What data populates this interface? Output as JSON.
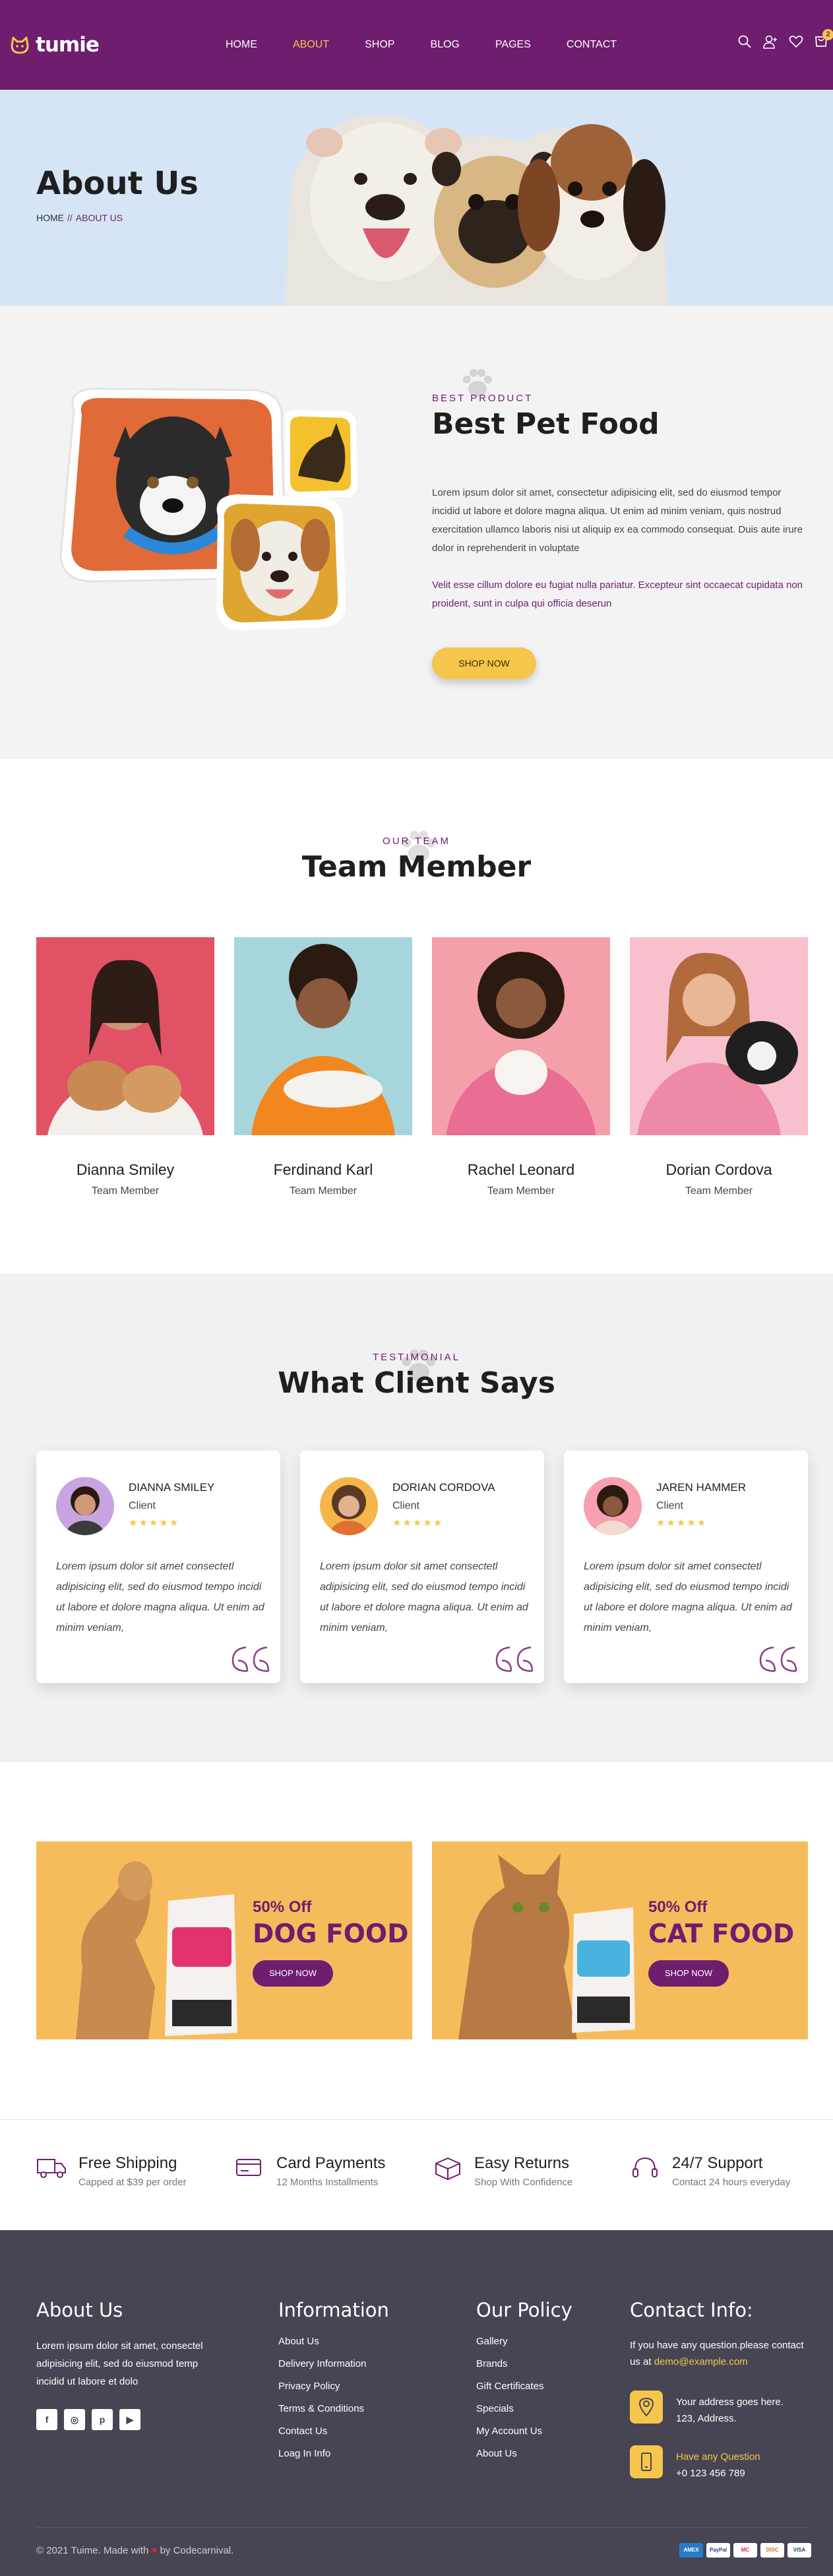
{
  "colors": {
    "brand": "#6e1d6f",
    "accent": "#f6c64c",
    "banner_bg": "#d5e5f5",
    "footer_bg": "#474553"
  },
  "header": {
    "logo": "tumie",
    "nav": [
      {
        "label": "HOME"
      },
      {
        "label": "ABOUT"
      },
      {
        "label": "SHOP"
      },
      {
        "label": "BLOG"
      },
      {
        "label": "PAGES"
      },
      {
        "label": "CONTACT"
      }
    ],
    "active_nav": "ABOUT",
    "icons": [
      "search-icon",
      "user-icon",
      "heart-icon",
      "cart-icon"
    ],
    "cart_count": "2"
  },
  "banner": {
    "title": "About Us",
    "crumb_home": "HOME",
    "crumb_sep": "//",
    "crumb_current": "ABOUT US"
  },
  "about": {
    "eyebrow": "BEST PRODUCT",
    "title": "Best Pet Food",
    "para1": "Lorem ipsum dolor sit amet, consectetur adipisicing elit, sed do eiusmod tempor incidid ut labore et dolore magna aliqua. Ut enim ad minim veniam, quis nostrud exercitation ullamco laboris nisi ut aliquip ex ea commodo consequat. Duis aute irure dolor in reprehenderit in voluptate",
    "para2": "Velit esse cillum dolore eu fugiat nulla pariatur. Excepteur sint occaecat cupidata non proident, sunt in culpa qui officia deserun",
    "button": "SHOP NOW"
  },
  "team": {
    "eyebrow": "OUR TEAM",
    "title": "Team Member",
    "members": [
      {
        "name": "Dianna Smiley",
        "role": "Team Member"
      },
      {
        "name": "Ferdinand Karl",
        "role": "Team Member"
      },
      {
        "name": "Rachel Leonard",
        "role": "Team Member"
      },
      {
        "name": "Dorian Cordova",
        "role": "Team Member"
      }
    ]
  },
  "testimonial": {
    "eyebrow": "TESTIMONIAL",
    "title": "What Client Says",
    "items": [
      {
        "name": "DIANNA SMILEY",
        "role": "Client",
        "stars": "★★★★★",
        "rating": 5,
        "text": "Lorem ipsum dolor sit amet consectetl adipisicing elit, sed do eiusmod tempo incidi ut labore et dolore magna aliqua. Ut enim ad minim veniam,"
      },
      {
        "name": "DORIAN CORDOVA",
        "role": "Client",
        "stars": "★★★★★",
        "rating": 5,
        "text": "Lorem ipsum dolor sit amet consectetl adipisicing elit, sed do eiusmod tempo incidi ut labore et dolore magna aliqua. Ut enim ad minim veniam,"
      },
      {
        "name": "JAREN HAMMER",
        "role": "Client",
        "stars": "★★★★★",
        "rating": 5,
        "text": "Lorem ipsum dolor sit amet consectetl adipisicing elit, sed do eiusmod tempo incidi ut labore et dolore magna aliqua. Ut enim ad minim veniam,"
      }
    ]
  },
  "promos": [
    {
      "offer": "50% Off",
      "title": "DOG FOOD",
      "button": "SHOP NOW"
    },
    {
      "offer": "50% Off",
      "title": "CAT FOOD",
      "button": "SHOP NOW"
    }
  ],
  "features": [
    {
      "icon": "truck-icon",
      "title": "Free Shipping",
      "sub": "Capped at $39 per order"
    },
    {
      "icon": "card-icon",
      "title": "Card Payments",
      "sub": "12 Months Installments"
    },
    {
      "icon": "box-icon",
      "title": "Easy Returns",
      "sub": "Shop With Confidence"
    },
    {
      "icon": "headset-icon",
      "title": "24/7 Support",
      "sub": "Contact 24 hours everyday"
    }
  ],
  "footer": {
    "about_title": "About Us",
    "about_text": "Lorem ipsum dolor sit amet, consectel adipisicing elit, sed do eiusmod temp incidid ut labore et dolo",
    "social": [
      {
        "icon": "facebook-icon",
        "glyph": "f"
      },
      {
        "icon": "instagram-icon",
        "glyph": "◎"
      },
      {
        "icon": "pinterest-icon",
        "glyph": "p"
      },
      {
        "icon": "youtube-icon",
        "glyph": "▶"
      }
    ],
    "info_title": "Information",
    "info_links": [
      {
        "label": "About Us"
      },
      {
        "label": "Delivery Information"
      },
      {
        "label": "Privacy Policy"
      },
      {
        "label": "Terms & Conditions"
      },
      {
        "label": "Contact Us"
      },
      {
        "label": "Loag In Info"
      }
    ],
    "policy_title": "Our Policy",
    "policy_links": [
      {
        "label": "Gallery"
      },
      {
        "label": "Brands"
      },
      {
        "label": "Gift Certificates"
      },
      {
        "label": "Specials"
      },
      {
        "label": "My Account Us"
      },
      {
        "label": "About Us"
      }
    ],
    "contact_title": "Contact Info:",
    "contact_intro": "If you have any question.please contact us at",
    "email": "demo@example.com",
    "address_1": "Your address goes here.",
    "address_2": "123, Address.",
    "question_label": "Have any Question",
    "phone": "+0 123 456 789",
    "copyright_pre": "© 2021 Tuime. Made with",
    "copyright_post": "by Codecarnival.",
    "payments": [
      {
        "label": "AMEX"
      },
      {
        "label": "PayPal"
      },
      {
        "label": "MC"
      },
      {
        "label": "DISC"
      },
      {
        "label": "VISA"
      }
    ]
  }
}
